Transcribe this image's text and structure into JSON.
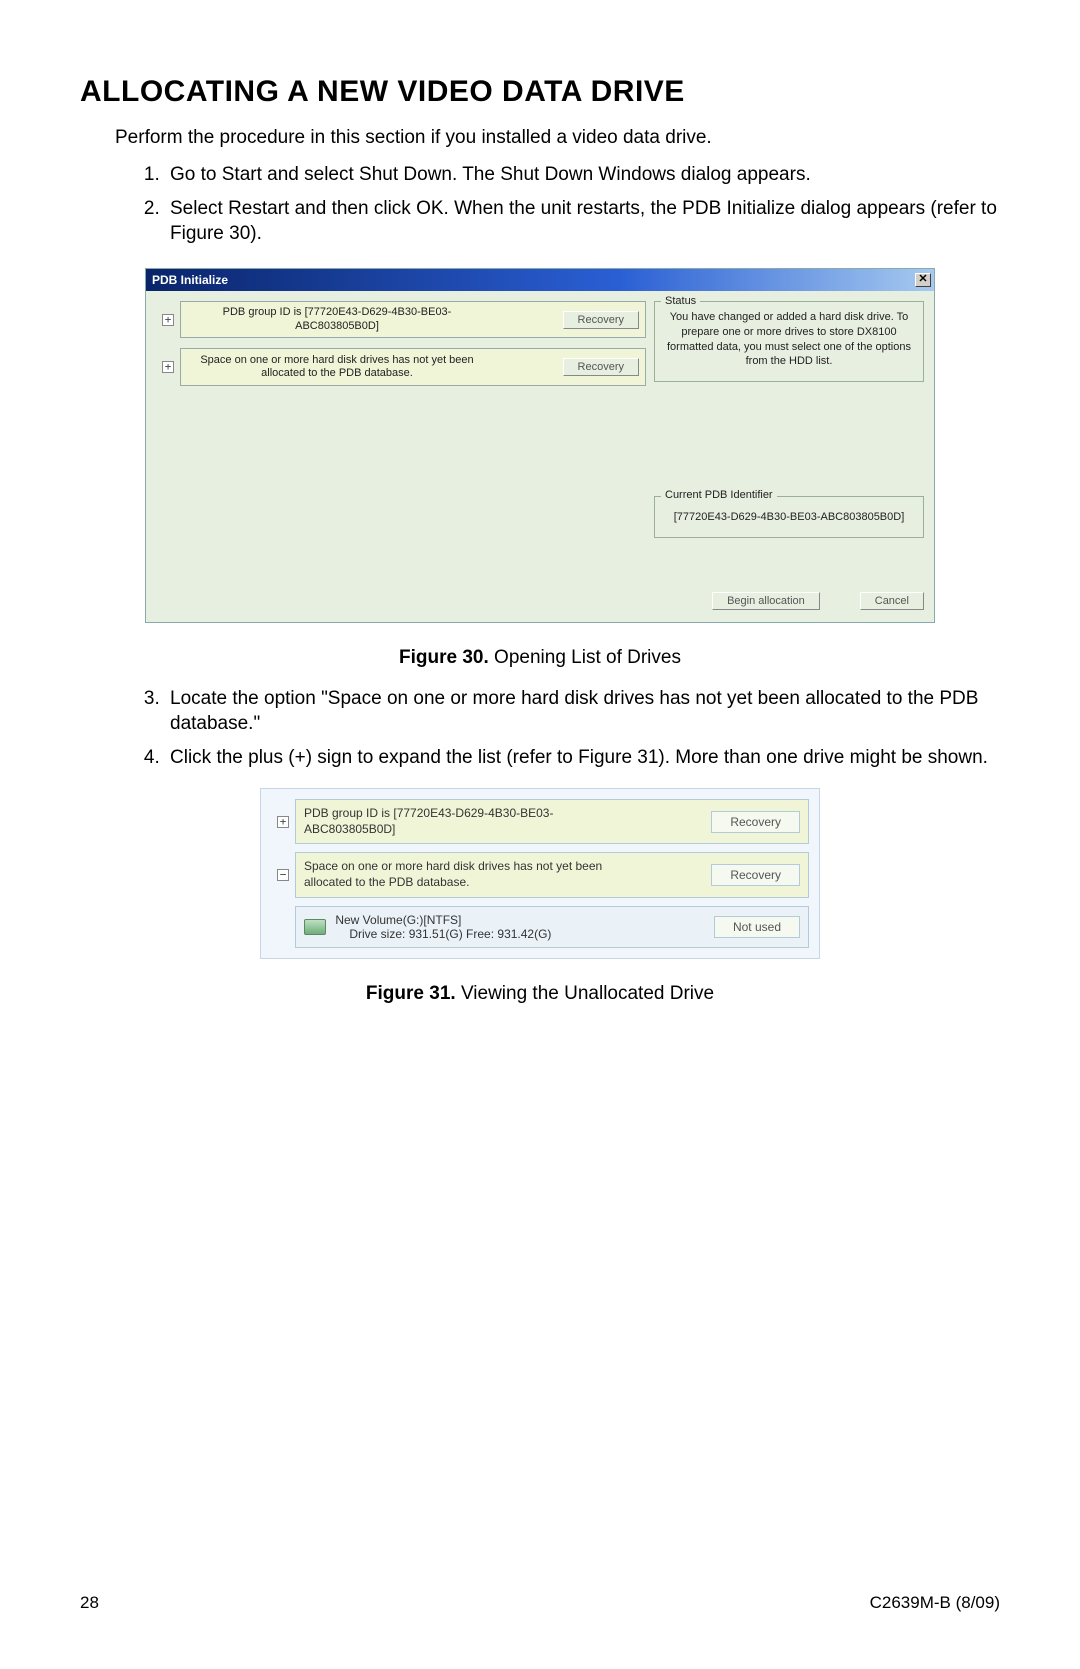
{
  "title": "ALLOCATING A NEW VIDEO DATA DRIVE",
  "intro": "Perform the procedure in this section if you installed a video data drive.",
  "steps12": [
    "Go to Start and select Shut Down. The Shut Down Windows dialog appears.",
    "Select Restart and then click OK. When the unit restarts, the PDB Initialize dialog appears (refer to Figure 30)."
  ],
  "fig30": {
    "caption_label": "Figure 30.",
    "caption_text": "Opening List of Drives",
    "window_title": "PDB Initialize",
    "close_glyph": "✕",
    "rows": [
      {
        "expand": "+",
        "text": "PDB group ID is [77720E43-D629-4B30-BE03-ABC803805B0D]",
        "btn": "Recovery"
      },
      {
        "expand": "+",
        "text": "Space on one or more hard disk drives has not yet been allocated to the PDB database.",
        "btn": "Recovery"
      }
    ],
    "status_title": "Status",
    "status_text": "You have changed or added a hard disk drive. To prepare one or more drives to store DX8100 formatted data, you must select one of the options from the HDD list.",
    "id_title": "Current PDB Identifier",
    "id_value": "[77720E43-D629-4B30-BE03-ABC803805B0D]",
    "begin_btn": "Begin allocation",
    "cancel_btn": "Cancel"
  },
  "steps34": [
    "Locate the option \"Space on one or more hard disk drives has not yet been allocated to the PDB database.\"",
    "Click the plus (+) sign to expand the list (refer to Figure 31). More than one drive might be shown."
  ],
  "fig31": {
    "caption_label": "Figure 31.",
    "caption_text": "Viewing the Unallocated Drive",
    "rows": [
      {
        "expand": "+",
        "text": "PDB group ID is [77720E43-D629-4B30-BE03-ABC803805B0D]",
        "btn": "Recovery"
      },
      {
        "expand": "−",
        "text": "Space on one or more hard disk drives has not yet been allocated to the PDB database.",
        "btn": "Recovery"
      }
    ],
    "drive_line1": "New Volume(G:)[NTFS]",
    "drive_line2": "Drive size: 931.51(G) Free: 931.42(G)",
    "drive_status": "Not used"
  },
  "footer": {
    "page": "28",
    "doc": "C2639M-B (8/09)"
  }
}
